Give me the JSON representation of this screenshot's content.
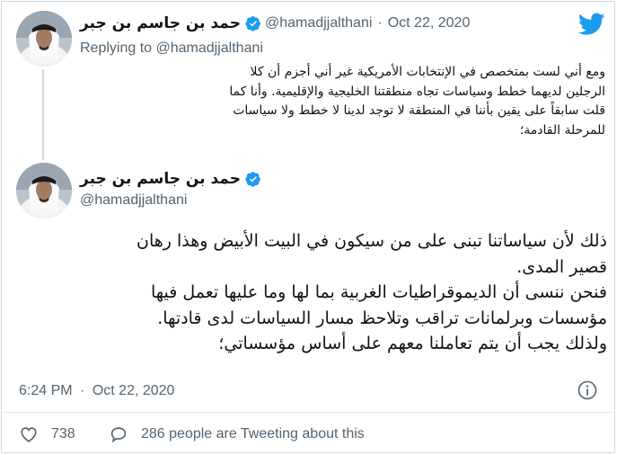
{
  "reply_tweet": {
    "author_name": "حمد بن جاسم بن جبر",
    "handle": "@hamadjjalthani",
    "separator": "·",
    "date": "Oct 22, 2020",
    "replying_prefix": "Replying to",
    "replying_handle": "@hamadjjalthani",
    "body_lines": [
      "ومع أني لست بمتخصص في الإنتخابات الأمريكية غير أني  أجزم أن كلا",
      "الرجلين لديهما خطط وسياسات تجاه منطقتنا الخليجية والإقليمية.  وأنا كما",
      "قلت سابقاً على يقين بأننا في المنطقة لا توجد لدينا لا خطط ولا سياسات",
      "للمرحلة القادمة؛"
    ]
  },
  "main_tweet": {
    "author_name": "حمد بن جاسم بن جبر",
    "handle": "@hamadjjalthani",
    "body_lines": [
      "ذلك لأن سياساتنا تبنى على من سيكون في البيت الأبيض وهذا رهان",
      "قصير المدى.",
      "فنحن ننسى أن الديموقراطيات الغربية بما لها وما عليها تعمل فيها",
      "مؤسسات وبرلمانات تراقب وتلاحظ مسار السياسات لدى قادتها.",
      "ولذلك يجب أن يتم تعاملنا معهم على أساس مؤسساتي؛"
    ],
    "time": "6:24 PM",
    "separator": "·",
    "date": "Oct 22, 2020",
    "likes": "738",
    "tweeting_about": "286 people are Tweeting about this"
  },
  "colors": {
    "twitter_blue": "#1d9bf0",
    "secondary_text": "#536471",
    "border": "#cfd9de"
  },
  "icons": [
    "twitter-logo-icon",
    "verified-badge-icon",
    "info-icon",
    "heart-icon",
    "comment-icon"
  ]
}
